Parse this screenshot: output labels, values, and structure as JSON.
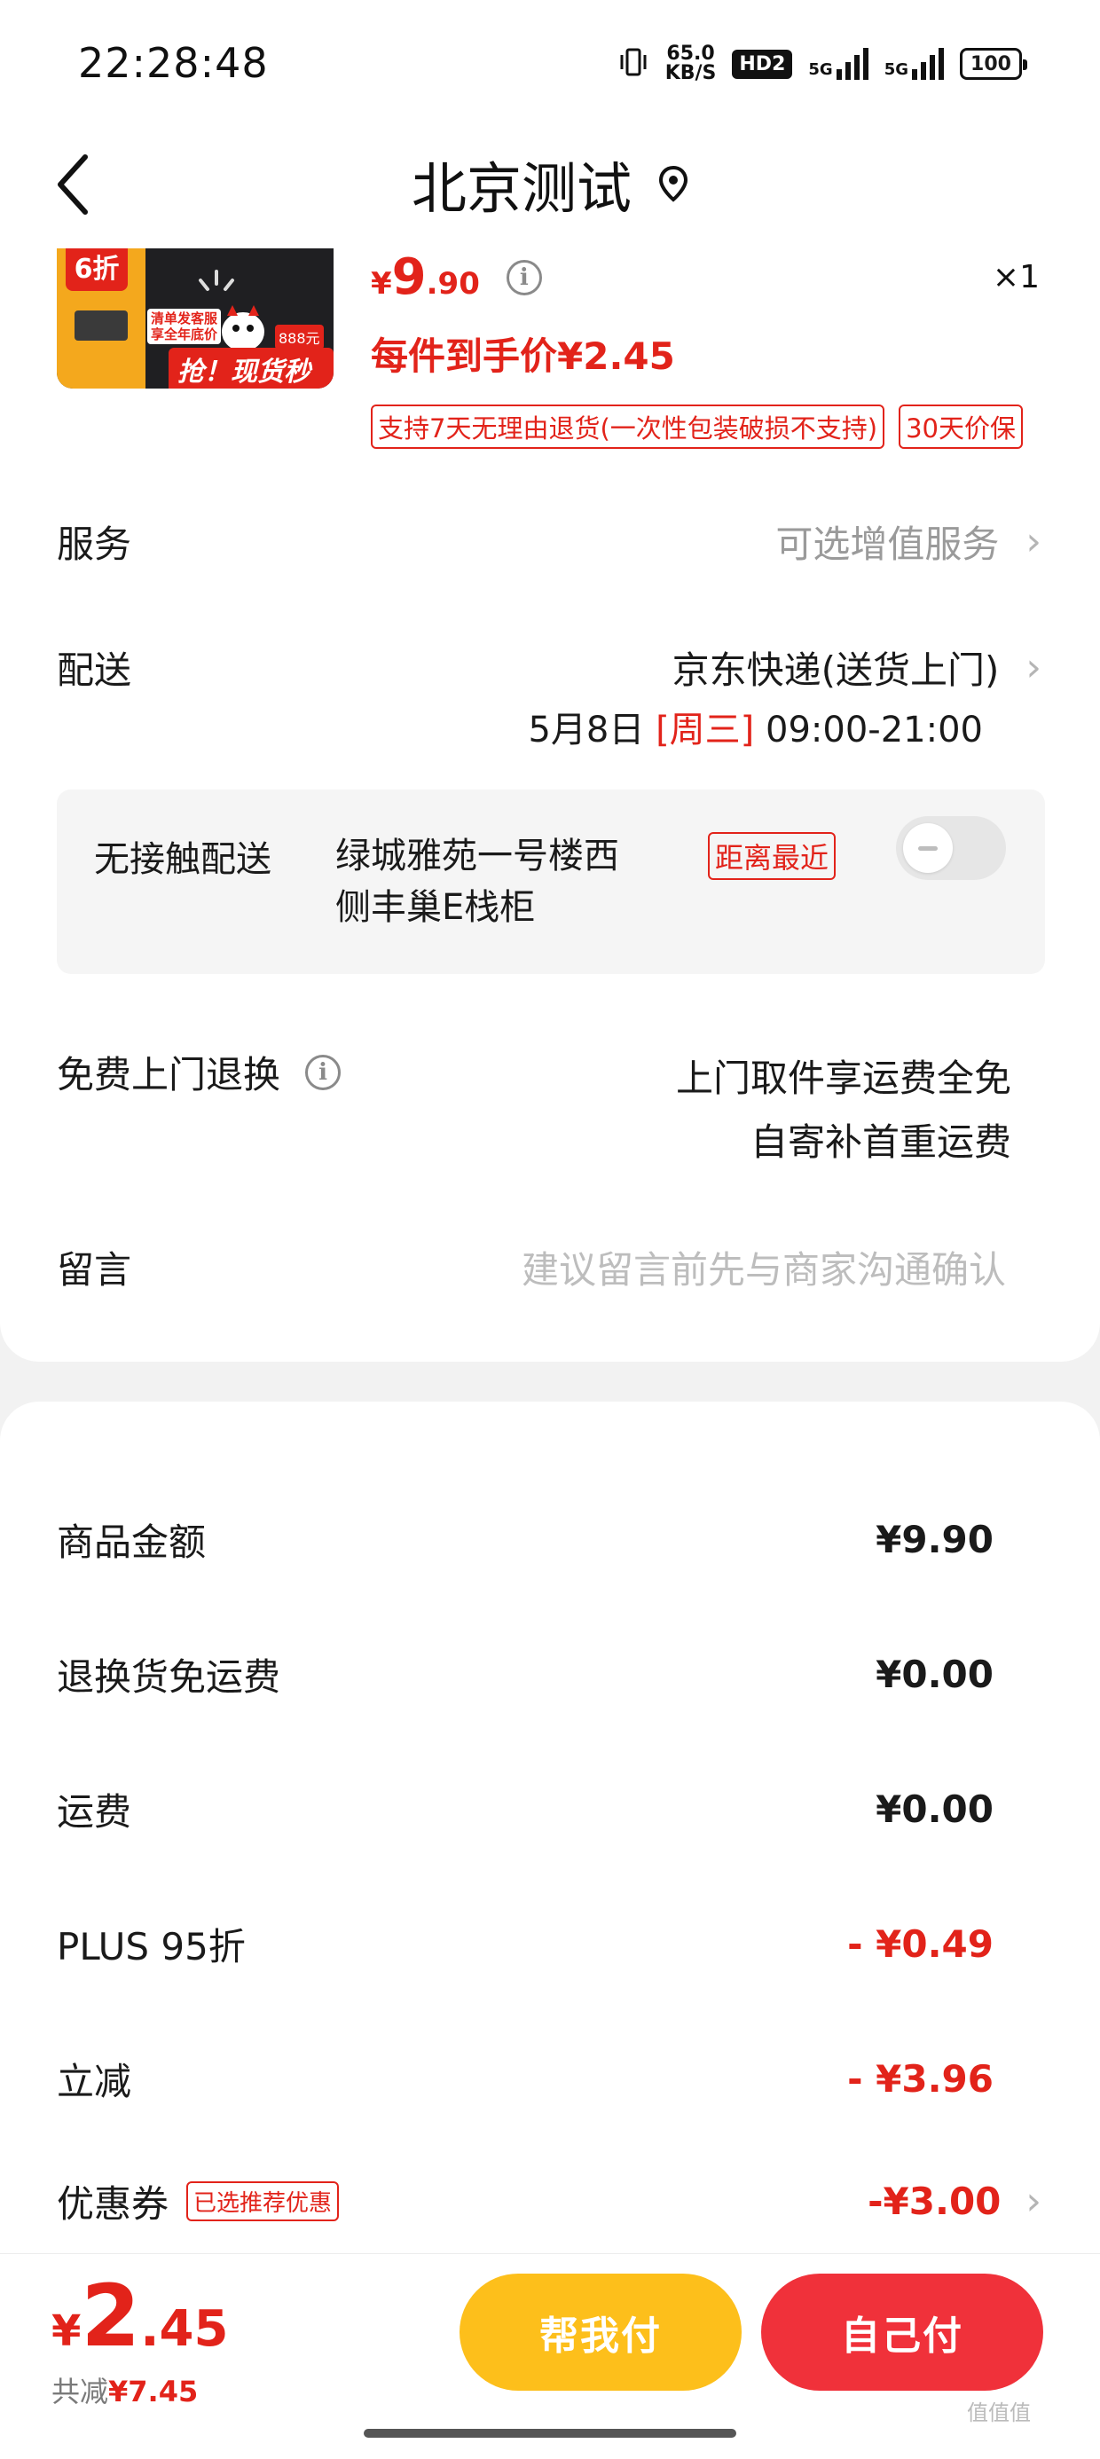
{
  "status": {
    "time": "22:28:48",
    "speed_value": "65.0",
    "speed_unit": "KB/S",
    "hd": "HD2",
    "net1": "5G",
    "net2": "5G",
    "battery": "100"
  },
  "header": {
    "title": "北京测试"
  },
  "product": {
    "thumb": {
      "discount": "6折",
      "promo1": "清单发客服",
      "promo2": "享全年底价",
      "promo3": "888元",
      "slogan": "抢！现货秒发"
    },
    "price_yen": "¥",
    "price_int": "9",
    "price_dec": ".90",
    "qty": "×1",
    "unit_price": "每件到手价¥2.45",
    "tag_return": "支持7天无理由退货(一次性包装破损不支持)",
    "tag_price": "30天价保"
  },
  "service": {
    "label": "服务",
    "value": "可选增值服务"
  },
  "delivery": {
    "label": "配送",
    "method": "京东快递(送货上门)",
    "date": "5月8日",
    "weekday": "[周三]",
    "time_range": "09:00-21:00"
  },
  "contactless": {
    "label": "无接触配送",
    "address_line1": "绿城雅苑一号楼西",
    "address_line2": "侧丰巢E栈柜",
    "badge": "距离最近",
    "enabled": false
  },
  "free_return": {
    "label": "免费上门退换",
    "line1": "上门取件享运费全免",
    "line2": "自寄补首重运费"
  },
  "message": {
    "label": "留言",
    "placeholder": "建议留言前先与商家沟通确认"
  },
  "summary": {
    "rows": [
      {
        "label": "商品金额",
        "value": "¥9.90"
      },
      {
        "label": "退换货免运费",
        "value": "¥0.00"
      },
      {
        "label": "运费",
        "value": "¥0.00"
      },
      {
        "label": "PLUS 95折",
        "value": "- ¥0.49"
      },
      {
        "label": "立减",
        "value": "- ¥3.96"
      }
    ],
    "coupon_label": "优惠券",
    "coupon_badge": "已选推荐优惠",
    "coupon_value": "-¥3.00"
  },
  "footer": {
    "total_yen": "¥",
    "total_int": "2",
    "total_dec": ".45",
    "saved_label": "共减",
    "saved_value": "¥7.45",
    "help_pay": "帮我付",
    "self_pay": "自己付"
  },
  "watermark": "值值值"
}
